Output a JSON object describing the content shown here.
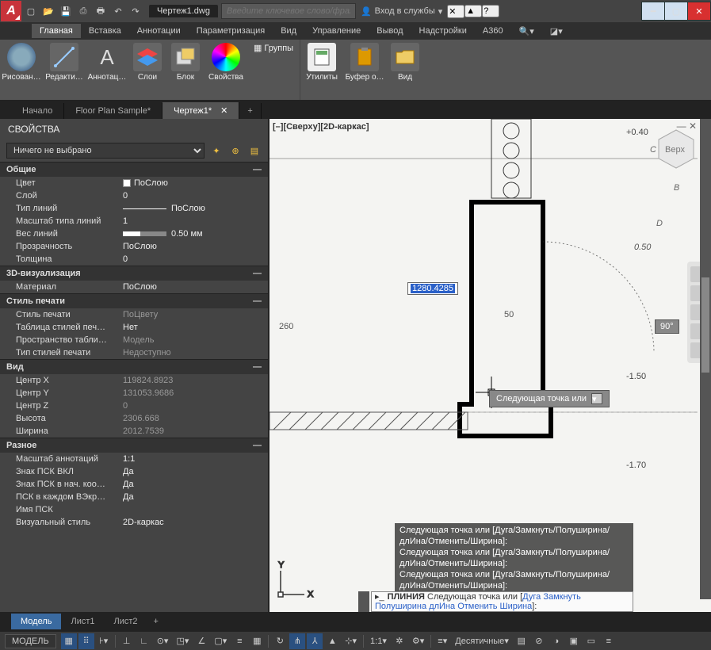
{
  "titlebar": {
    "doc": "Чертеж1.dwg",
    "search_placeholder": "Введите ключевое слово/фразу",
    "signin": "Вход в службы"
  },
  "menu": {
    "tabs": [
      "Главная",
      "Вставка",
      "Аннотации",
      "Параметризация",
      "Вид",
      "Управление",
      "Вывод",
      "Надстройки",
      "A360"
    ],
    "active": 0
  },
  "ribbon": {
    "groups": [
      {
        "label": "Рисован…",
        "icon": "circle"
      },
      {
        "label": "Редакти…",
        "icon": "move"
      },
      {
        "label": "Аннотац…",
        "icon": "text-a"
      },
      {
        "label": "Слои",
        "icon": "layers"
      },
      {
        "label": "Блок",
        "icon": "block"
      },
      {
        "label": "Свойства",
        "icon": "color-wheel"
      },
      {
        "label": "Группы",
        "icon": "group",
        "top": true
      },
      {
        "label": "Утилиты",
        "icon": "calc"
      },
      {
        "label": "Буфер о…",
        "icon": "clipboard"
      },
      {
        "label": "Вид",
        "icon": "folder"
      }
    ]
  },
  "filetabs": {
    "tabs": [
      {
        "label": "Начало",
        "active": false
      },
      {
        "label": "Floor Plan Sample*",
        "active": false
      },
      {
        "label": "Чертеж1*",
        "active": true
      }
    ]
  },
  "palette": {
    "title": "СВОЙСТВА",
    "selector": "Ничего не выбрано",
    "sections": [
      {
        "title": "Общие",
        "rows": [
          {
            "l": "Цвет",
            "v": "ПоСлою",
            "swatch": true
          },
          {
            "l": "Слой",
            "v": "0"
          },
          {
            "l": "Тип линий",
            "v": "ПоСлою",
            "ltype": true
          },
          {
            "l": "Масштаб типа линий",
            "v": "1"
          },
          {
            "l": "Вес линий",
            "v": "0.50 мм",
            "lw": true
          },
          {
            "l": "Прозрачность",
            "v": "ПоСлою"
          },
          {
            "l": "Толщина",
            "v": "0"
          }
        ]
      },
      {
        "title": "3D-визуализация",
        "rows": [
          {
            "l": "Материал",
            "v": "ПоСлою"
          }
        ]
      },
      {
        "title": "Стиль печати",
        "rows": [
          {
            "l": "Стиль печати",
            "v": "ПоЦвету",
            "dim": true
          },
          {
            "l": "Таблица стилей печ…",
            "v": "Нет"
          },
          {
            "l": "Пространство табли…",
            "v": "Модель",
            "dim": true
          },
          {
            "l": "Тип стилей печати",
            "v": "Недоступно",
            "dim": true
          }
        ]
      },
      {
        "title": "Вид",
        "rows": [
          {
            "l": "Центр X",
            "v": "119824.8923",
            "dim": true
          },
          {
            "l": "Центр Y",
            "v": "131053.9686",
            "dim": true
          },
          {
            "l": "Центр Z",
            "v": "0",
            "dim": true
          },
          {
            "l": "Высота",
            "v": "2306.668",
            "dim": true
          },
          {
            "l": "Ширина",
            "v": "2012.7539",
            "dim": true
          }
        ]
      },
      {
        "title": "Разное",
        "rows": [
          {
            "l": "Масштаб аннотаций",
            "v": "1:1"
          },
          {
            "l": "Знак ПСК ВКЛ",
            "v": "Да"
          },
          {
            "l": "Знак ПСК в нач. коо…",
            "v": "Да"
          },
          {
            "l": "ПСК в каждом ВЭкр…",
            "v": "Да"
          },
          {
            "l": "Имя ПСК",
            "v": ""
          },
          {
            "l": "Визуальный стиль",
            "v": "2D-каркас"
          }
        ]
      }
    ]
  },
  "canvas": {
    "view_label": "[–][Сверху][2D-каркас]",
    "dyn_distance": "1280.4285",
    "angle": "90°",
    "tooltip": "Следующая точка или",
    "viewcube_face": "Верх",
    "scene_text": {
      "dim_top": "+0.40",
      "dim_50": "50",
      "dim_260": "260",
      "dim_150": "-1.50",
      "dim_170": "-1.70",
      "dim_050": "0.50",
      "c": "C",
      "b": "B",
      "d": "D"
    }
  },
  "cmd": {
    "history_line": "Следующая точка или [Дуга/Замкнуть/Полуширина/длИна/Отменить/Ширина]:",
    "prompt_cmd": "ПЛИНИЯ",
    "prompt_text": "Следующая точка или [",
    "opts": [
      "Дуга",
      "Замкнуть",
      "Полуширина",
      "длИна",
      "Отменить",
      "Ширина"
    ],
    "prompt_end": "]:"
  },
  "modeltabs": {
    "tabs": [
      {
        "label": "Модель",
        "active": true
      },
      {
        "label": "Лист1"
      },
      {
        "label": "Лист2"
      }
    ]
  },
  "status": {
    "model": "МОДЕЛЬ",
    "scale": "1:1",
    "units": "Десятичные"
  }
}
